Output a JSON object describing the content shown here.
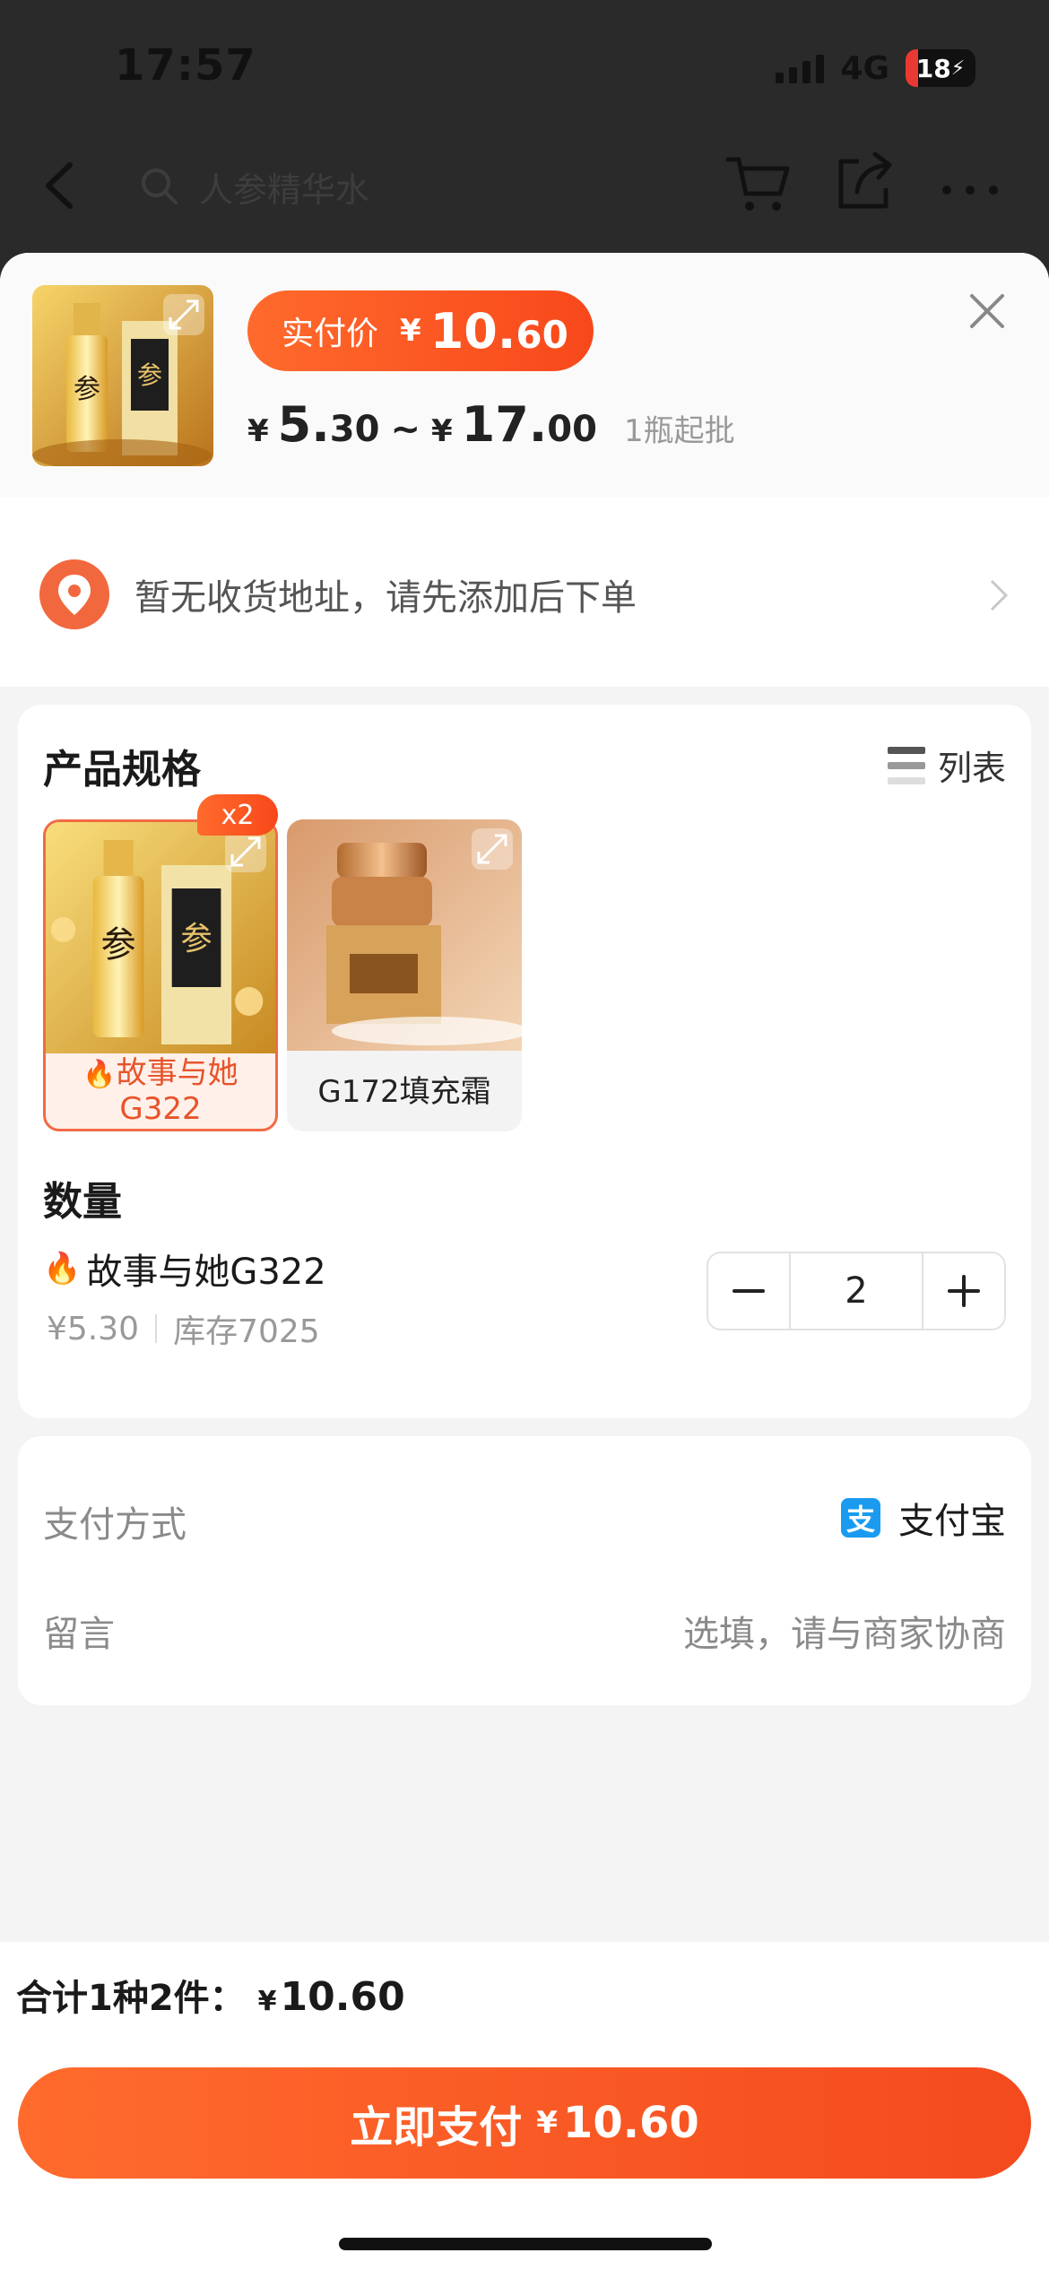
{
  "status_bar": {
    "time": "17:57",
    "network": "4G",
    "battery": "18"
  },
  "nav": {
    "search_placeholder": "人参精华水"
  },
  "header": {
    "pay_label": "实付价",
    "currency": "¥",
    "pay_amount_int": "10.",
    "pay_amount_dec": "60",
    "price_min_int": "5.",
    "price_min_dec": "30",
    "price_max_int": "17.",
    "price_max_dec": "00",
    "range_sep": "~",
    "moq": "1瓶起批"
  },
  "address": {
    "text": "暂无收货地址，请先添加后下单"
  },
  "spec": {
    "title": "产品规格",
    "view_toggle": "列表",
    "variants": [
      {
        "label_line1": "故事与她",
        "label_line2": "G322",
        "badge": "x2",
        "selected": true
      },
      {
        "label_line1": "G172填充霜",
        "label_line2": "",
        "selected": false
      }
    ]
  },
  "quantity": {
    "title": "数量",
    "item_name": "故事与她G322",
    "unit_price": "¥5.30",
    "stock": "库存7025",
    "value": "2"
  },
  "payment": {
    "method_label": "支付方式",
    "method_value": "支付宝",
    "method_icon": "支",
    "note_label": "留言",
    "note_placeholder": "选填，请与商家协商"
  },
  "footer": {
    "total_label": "合计1种2件：",
    "currency": "¥",
    "total_amount": "10.60",
    "pay_button_label": "立即支付",
    "pay_button_amount": "10.60"
  },
  "colors": {
    "accent": "#F8481B",
    "alipay": "#1A9BF0"
  }
}
